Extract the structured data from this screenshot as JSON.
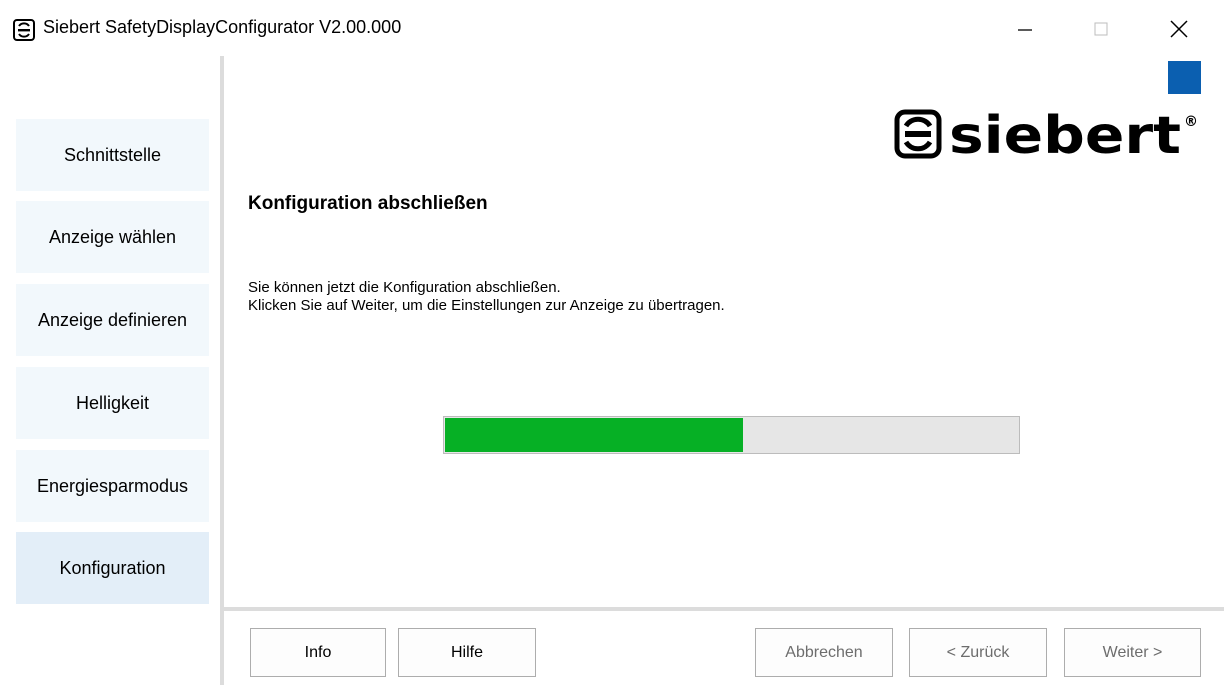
{
  "window": {
    "title": "Siebert SafetyDisplayConfigurator V2.00.000",
    "min_glyph": "—",
    "close_glyph": "✕"
  },
  "sidebar": {
    "items": [
      {
        "label": "Schnittstelle"
      },
      {
        "label": "Anzeige wählen"
      },
      {
        "label": "Anzeige definieren"
      },
      {
        "label": "Helligkeit"
      },
      {
        "label": "Energiesparmodus"
      },
      {
        "label": "Konfiguration",
        "active": true
      }
    ]
  },
  "main": {
    "logo_text": "siebert",
    "logo_mark": "®",
    "heading": "Konfiguration abschließen",
    "line1": "Sie können jetzt die Konfiguration abschließen.",
    "line2": "Klicken Sie auf Weiter, um die Einstellungen zur Anzeige zu übertragen.",
    "progress": 0.52,
    "progress_color": "#06b025",
    "accent_color": "#0b5fb0"
  },
  "buttons": {
    "info": "Info",
    "help": "Hilfe",
    "cancel": "Abbrechen",
    "back": "< Zurück",
    "next": "Weiter >"
  }
}
